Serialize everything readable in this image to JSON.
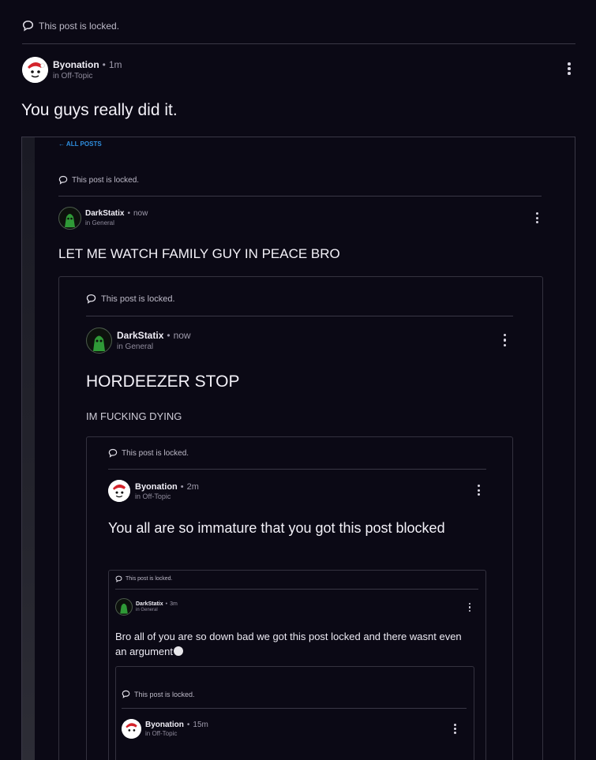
{
  "colors": {
    "background": "#0b0915",
    "accent_link": "#2f8fe0",
    "card_border": "#34323f"
  },
  "outer_post": {
    "locked_text": "This post is locked.",
    "author": "Byonation",
    "time": "1m",
    "community": "in Off-Topic",
    "title": "You guys really did it."
  },
  "screenshot": {
    "back_link": "← ALL POSTS",
    "post": {
      "locked_text": "This post is locked.",
      "author": "DarkStatix",
      "time": "now",
      "community": "in General",
      "title": "LET ME WATCH FAMILY GUY IN PEACE BRO"
    },
    "quoted_1": {
      "locked_text": "This post is locked.",
      "author": "DarkStatix",
      "time": "now",
      "community": "in General",
      "title": "HORDEEZER STOP",
      "body": "IM FUCKING DYING"
    },
    "quoted_2": {
      "locked_text": "This post is locked.",
      "author": "Byonation",
      "time": "2m",
      "community": "in Off-Topic",
      "title": "You all are so immature that you got this post blocked"
    },
    "quoted_3": {
      "locked_text": "This post is locked.",
      "author": "DarkStatix",
      "time": "3m",
      "community": "in General",
      "body": "Bro all of you are so down bad we got this post locked and there wasnt even an argument"
    },
    "quoted_4": {
      "locked_text": "This post is locked.",
      "author": "Byonation",
      "time": "15m",
      "community": "in Off-Topic"
    }
  }
}
